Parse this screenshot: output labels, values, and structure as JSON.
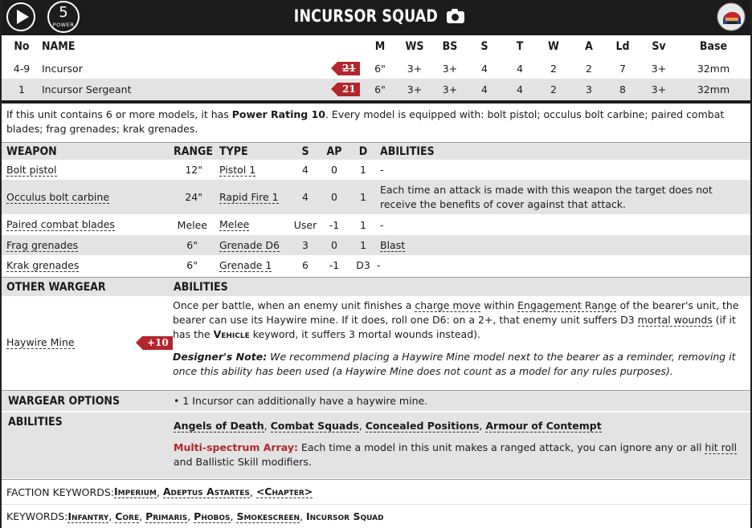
{
  "header": {
    "title": "INCURSOR SQUAD",
    "power": {
      "value": "5",
      "label": "POWER"
    }
  },
  "stats": {
    "headers": [
      "No",
      "NAME",
      "M",
      "WS",
      "BS",
      "S",
      "T",
      "W",
      "A",
      "Ld",
      "Sv",
      "Base"
    ],
    "rows": [
      {
        "no": "4-9",
        "name": "Incursor",
        "points": "21",
        "points_struck": true,
        "M": "6\"",
        "WS": "3+",
        "BS": "3+",
        "S": "4",
        "T": "4",
        "W": "2",
        "A": "2",
        "Ld": "7",
        "Sv": "3+",
        "Base": "32mm"
      },
      {
        "no": "1",
        "name": "Incursor Sergeant",
        "points": "21",
        "points_struck": false,
        "M": "6\"",
        "WS": "3+",
        "BS": "3+",
        "S": "4",
        "T": "4",
        "W": "2",
        "A": "3",
        "Ld": "8",
        "Sv": "3+",
        "Base": "32mm"
      }
    ]
  },
  "composition": {
    "before": "If this unit contains 6 or more models, it has ",
    "power_rating": "Power Rating 10",
    "after": ". Every model is equipped with: bolt pistol; occulus bolt carbine; paired combat blades; frag grenades; krak grenades."
  },
  "weapons": {
    "headers": [
      "WEAPON",
      "RANGE",
      "TYPE",
      "S",
      "AP",
      "D",
      "ABILITIES"
    ],
    "rows": [
      {
        "name": "Bolt pistol",
        "range": "12\"",
        "type": "Pistol 1",
        "s": "4",
        "ap": "0",
        "d": "1",
        "abilities": "-"
      },
      {
        "name": "Occulus bolt carbine",
        "range": "24\"",
        "type": "Rapid Fire 1",
        "s": "4",
        "ap": "0",
        "d": "1",
        "abilities": "Each time an attack is made with this weapon the target does not receive the benefits of cover against that attack."
      },
      {
        "name": "Paired combat blades",
        "range": "Melee",
        "type": "Melee",
        "s": "User",
        "ap": "-1",
        "d": "1",
        "abilities": "-"
      },
      {
        "name": "Frag grenades",
        "range": "6\"",
        "type": "Grenade D6",
        "s": "3",
        "ap": "0",
        "d": "1",
        "abilities": "Blast"
      },
      {
        "name": "Krak grenades",
        "range": "6\"",
        "type": "Grenade 1",
        "s": "6",
        "ap": "-1",
        "d": "D3",
        "abilities": "-"
      }
    ]
  },
  "wargear": {
    "headers": [
      "OTHER WARGEAR",
      "ABILITIES"
    ],
    "name": "Haywire Mine",
    "points": "+10",
    "text1": "Once per battle, when an enemy unit finishes a ",
    "charge_move": "charge move",
    "text2": " within ",
    "engagement_range": "Engagement Range",
    "text3": " of the bearer's unit, the bearer can use its Haywire mine. If it does, roll one D6: on a 2+, that enemy unit suffers D3 ",
    "mortal_wounds": "mortal wounds",
    "text4": " (if it has the ",
    "vehicle": "Vehicle",
    "text5": " keyword, it suffers 3 mortal wounds instead).",
    "designer_label": "Designer's Note:",
    "designer_text": " We recommend placing a Haywire Mine model next to the bearer as a reminder, removing it once this ability has been used (a Haywire Mine does not count as a model for any rules purposes)."
  },
  "wargear_options": {
    "label": "WARGEAR OPTIONS",
    "text": "• 1 Incursor can additionally have a haywire mine."
  },
  "abilities": {
    "label": "ABILITIES",
    "core": [
      "Angels of Death",
      "Combat Squads",
      "Concealed Positions",
      "Armour of Contempt"
    ],
    "ms_label": "Multi-spectrum Array:",
    "ms_text1": " Each time a model in this unit makes a ranged attack, you can ignore any or all ",
    "hit_roll": "hit roll",
    "ms_text2": " and Ballistic Skill modifiers."
  },
  "faction_keywords": {
    "label": "FACTION KEYWORDS: ",
    "items": [
      "Imperium",
      "Adeptus Astartes",
      "<Chapter>"
    ]
  },
  "keywords": {
    "label": "KEYWORDS: ",
    "items": [
      "Infantry",
      "Core",
      "Primaris",
      "Phobos",
      "Smokescreen",
      "Incursor Squad"
    ]
  },
  "colors": {
    "header_bg": "#1c1c1c",
    "accent_red": "#b3262b",
    "row_grey": "#e3e3e3"
  },
  "icons": [
    "play-icon",
    "camera-icon",
    "helmet-icon"
  ]
}
